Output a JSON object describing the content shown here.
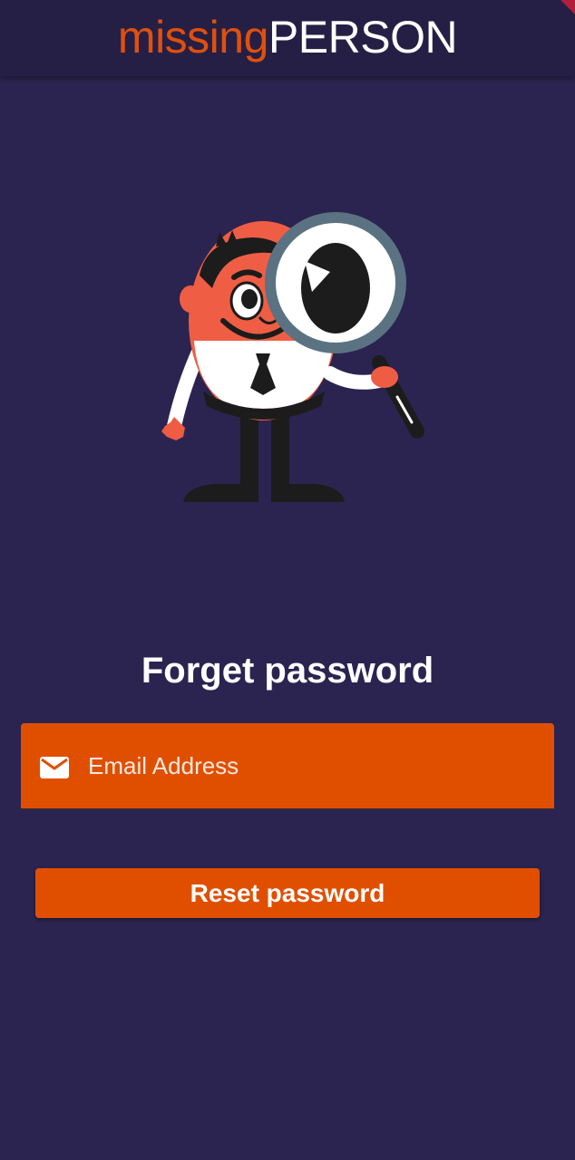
{
  "app_bar": {
    "brand_part1": "missing",
    "brand_part2": "PERSON"
  },
  "illustration": {
    "icon": "detective-magnifier-icon"
  },
  "form": {
    "title": "Forget password",
    "email_placeholder": "Email Address",
    "email_value": "",
    "email_icon": "mail-icon",
    "submit_label": "Reset password"
  },
  "colors": {
    "background": "#2b2450",
    "app_bar": "#261f45",
    "accent": "#e04f00",
    "text": "#ffffff"
  }
}
